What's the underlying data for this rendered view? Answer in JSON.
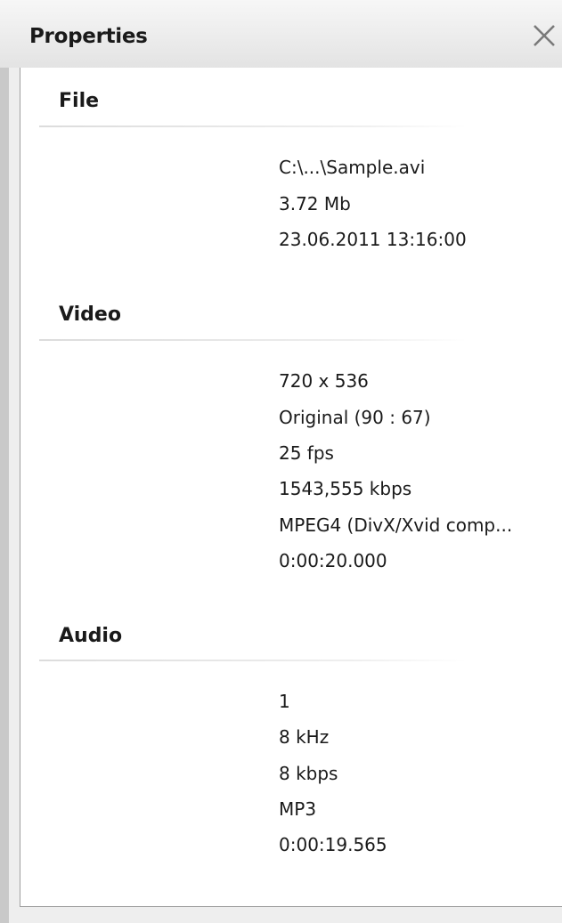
{
  "panel": {
    "title": "Properties"
  },
  "sections": {
    "file": {
      "title": "File",
      "values": [
        "C:\\...\\Sample.avi",
        "3.72 Mb",
        "23.06.2011 13:16:00"
      ]
    },
    "video": {
      "title": "Video",
      "values": [
        "720 x 536",
        "Original (90 : 67)",
        "25 fps",
        "1543,555 kbps",
        "MPEG4 (DivX/Xvid comp...",
        "0:00:20.000"
      ]
    },
    "audio": {
      "title": "Audio",
      "values": [
        "1",
        "8 kHz",
        "8 kbps",
        "MP3",
        "0:00:19.565"
      ]
    }
  },
  "icons": {
    "close": "close-icon"
  },
  "colors": {
    "titlebar": "#e8e8e8",
    "content_bg": "#ffffff",
    "text": "#1a1a1a",
    "border": "#a0a0a0"
  }
}
